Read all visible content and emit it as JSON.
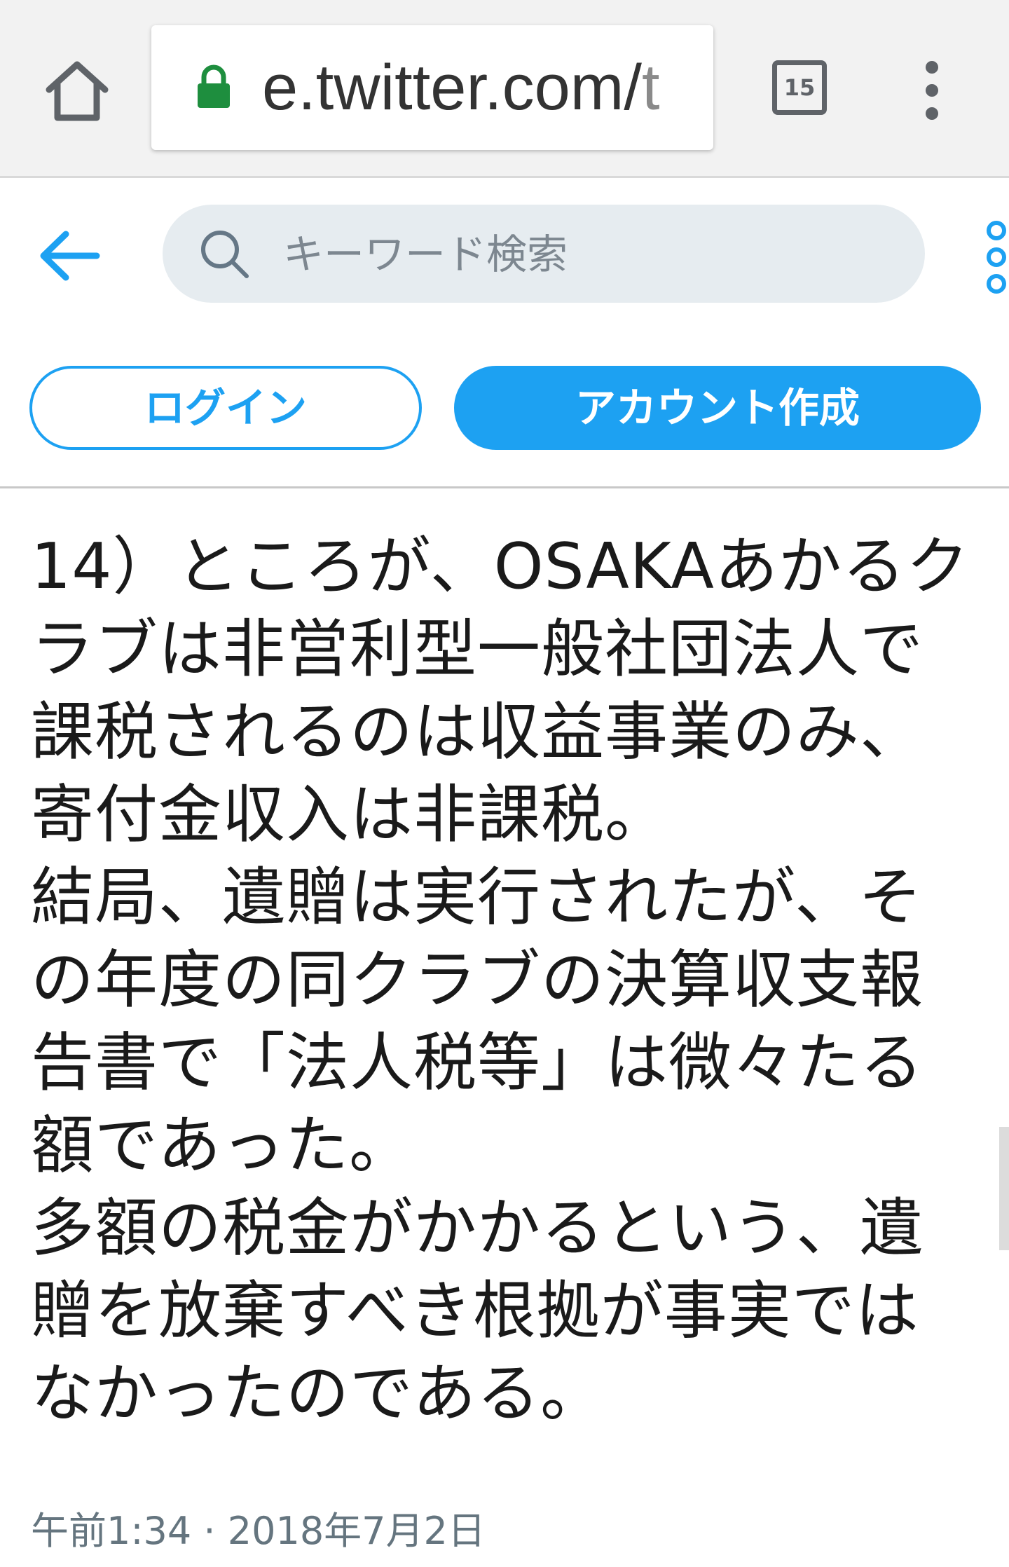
{
  "browser": {
    "url_host": "e.twitter.com/",
    "url_rest": "t",
    "tab_count": "15"
  },
  "header": {
    "search_placeholder": "キーワード検索"
  },
  "actions": {
    "login_label": "ログイン",
    "signup_label": "アカウント作成"
  },
  "tweet": {
    "lines": [
      "14）ところが、OSAKAあかるク",
      "ラブは非営利型一般社団法人で",
      "課税されるのは収益事業のみ、",
      "寄付金収入は非課税。",
      "結局、遺贈は実行されたが、そ",
      "の年度の同クラブの決算収支報",
      "告書で「法人税等」は微々たる",
      "額であった。",
      "多額の税金がかかるという、遺",
      "贈を放棄すべき根拠が事実では",
      "なかったのである。"
    ],
    "timestamp": "午前1:34 · 2018年7月2日"
  },
  "colors": {
    "accent": "#1da1f2",
    "lock_green": "#1e8e3e",
    "search_bg": "#e6ecf0",
    "timestamp": "#65757f"
  }
}
